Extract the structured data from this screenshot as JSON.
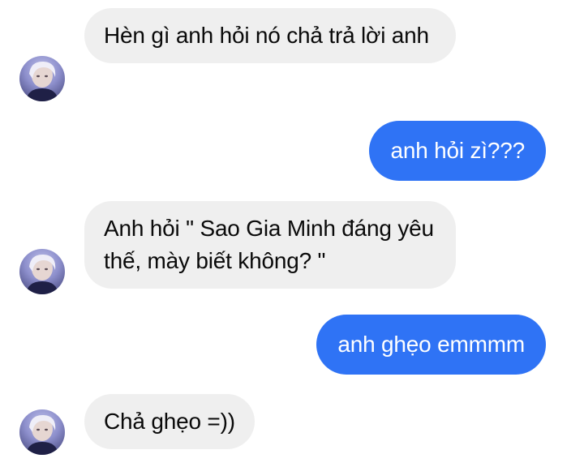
{
  "conversation": {
    "messages": [
      {
        "sender": "contact",
        "text": "Hèn gì anh hỏi nó chả trả lời anh"
      },
      {
        "sender": "me",
        "text": "anh hỏi zì???"
      },
      {
        "sender": "contact",
        "text": "Anh hỏi \" Sao Gia Minh đáng yêu thế, mày biết không? \""
      },
      {
        "sender": "me",
        "text": "anh ghẹo emmmm"
      },
      {
        "sender": "contact",
        "text": "Chả ghẹo =))"
      }
    ]
  },
  "colors": {
    "incoming_bubble": "#efefef",
    "outgoing_bubble": "#2f73f5",
    "incoming_text": "#0a0a0a",
    "outgoing_text": "#ffffff",
    "background": "#ffffff"
  },
  "icons": {
    "avatar": "contact-avatar-photo"
  }
}
